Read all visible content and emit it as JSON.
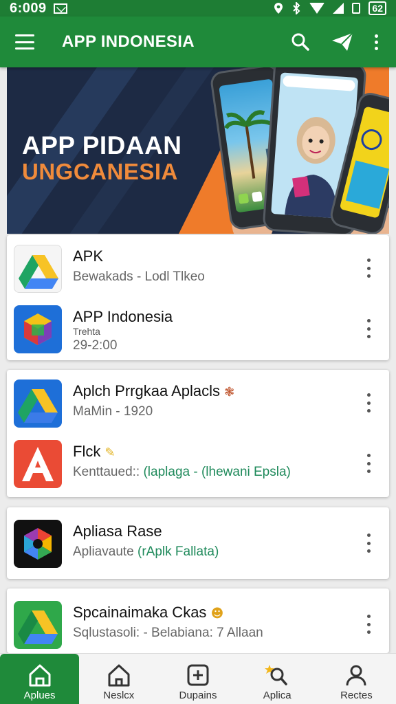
{
  "status_bar": {
    "time": "6:009",
    "battery": "62"
  },
  "app_bar": {
    "title": "APP INDONESIA"
  },
  "banner": {
    "line1": "APP PIDAAN",
    "line2": "UNGCANESIA"
  },
  "colors": {
    "primary": "#1f8a3a",
    "banner_bg": "#1d2a44",
    "banner_accent": "#ef7b2a",
    "link_green": "#1f8a5b"
  },
  "cards": [
    {
      "rows": [
        {
          "title": "APK",
          "subtitle": "Bewakads - Lodl Tlkeo",
          "icon": "drive-icon"
        },
        {
          "title": "APP Indonesia",
          "subtitle_small": "Trehta",
          "subtitle": "29-2:00",
          "icon": "cube-icon"
        }
      ]
    },
    {
      "rows": [
        {
          "title": "Aplch Prrgkaa Aplacls",
          "subtitle": "MaMin - 1920",
          "icon": "drive-icon"
        },
        {
          "title": "Flck",
          "subtitle_prefix": "Kenttaued::",
          "subtitle_accent": "(laplaga - (lhewani Epsla)",
          "icon": "letter-a-icon"
        }
      ]
    },
    {
      "rows": [
        {
          "title": "Apliasa Rase",
          "subtitle_prefix": "Apliavaute",
          "subtitle_accent": "(rAplk Fallata)",
          "icon": "hexagon-icon"
        }
      ]
    },
    {
      "rows": [
        {
          "title": "Spcainaimaka Ckas",
          "subtitle": "Sqlustasoli: - Belabiana: 7 Allaan",
          "icon": "drive-icon"
        }
      ]
    }
  ],
  "bottom_nav": [
    {
      "label": "Aplues",
      "icon": "home-icon",
      "active": true
    },
    {
      "label": "Neslcx",
      "icon": "home-outline-icon",
      "active": false
    },
    {
      "label": "Dupains",
      "icon": "plus-square-icon",
      "active": false
    },
    {
      "label": "Aplica",
      "icon": "search-star-icon",
      "active": false
    },
    {
      "label": "Rectes",
      "icon": "person-icon",
      "active": false
    }
  ]
}
